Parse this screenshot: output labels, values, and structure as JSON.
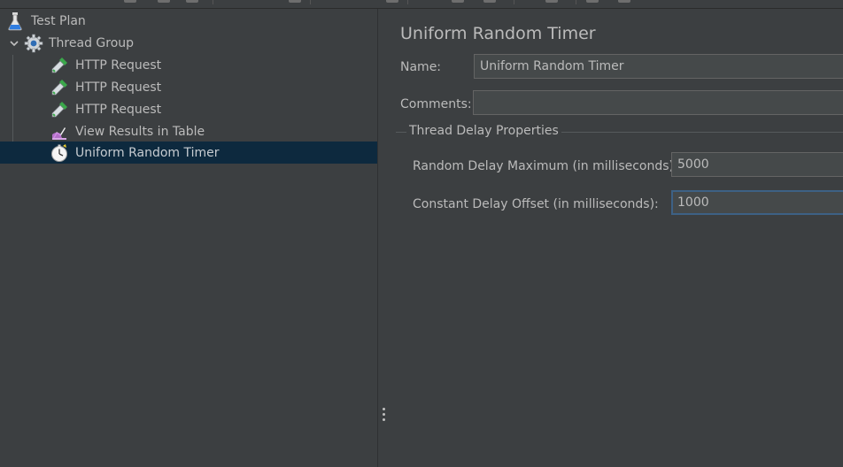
{
  "tree": {
    "items": [
      {
        "label": "Test Plan",
        "icon": "flask-icon"
      },
      {
        "label": "Thread Group",
        "icon": "gear-icon",
        "expanded": true
      },
      {
        "label": "HTTP Request",
        "icon": "pipette-icon"
      },
      {
        "label": "HTTP Request",
        "icon": "pipette-icon"
      },
      {
        "label": "HTTP Request",
        "icon": "pipette-icon"
      },
      {
        "label": "View Results in Table",
        "icon": "results-table-icon"
      },
      {
        "label": "Uniform Random Timer",
        "icon": "stopwatch-icon",
        "selected": true
      }
    ]
  },
  "editor": {
    "title": "Uniform Random Timer",
    "name_label": "Name:",
    "name_value": "Uniform Random Timer",
    "comments_label": "Comments:",
    "comments_value": "",
    "group_title": "Thread Delay Properties",
    "random_delay_label": "Random Delay Maximum (in milliseconds):",
    "random_delay_value": "5000",
    "constant_delay_label": "Constant Delay Offset (in milliseconds):",
    "constant_delay_value": "1000"
  },
  "colors": {
    "background": "#3c3f41",
    "selection": "#0d293e",
    "input_bg": "#45494a",
    "focus_border": "#3d6185",
    "text": "#bbbbbb"
  }
}
